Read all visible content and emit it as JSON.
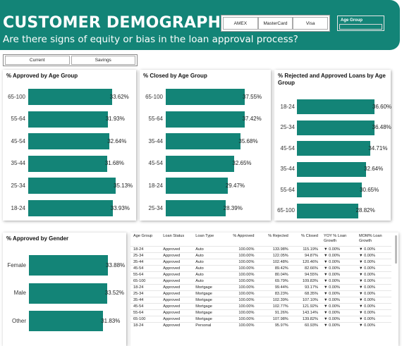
{
  "header": {
    "title": "CUSTOMER DEMOGRAPHICS",
    "subtitle": "Are there signs of equity or bias in the loan approval process?"
  },
  "card_filter": [
    "AMEX",
    "MasterCard",
    "Visa"
  ],
  "age_group_filter": {
    "label": "Age Group"
  },
  "account_toggle": [
    "Current",
    "Savings"
  ],
  "colors": {
    "accent": "#138477"
  },
  "chart_data": [
    {
      "type": "bar",
      "orientation": "horizontal",
      "title": "% Approved by Age Group",
      "categories": [
        "65-100",
        "55-64",
        "45-54",
        "35-44",
        "25-34",
        "18-24"
      ],
      "values": [
        33.62,
        31.93,
        32.64,
        31.68,
        35.13,
        33.93
      ],
      "labels": [
        "33.62%",
        "31.93%",
        "32.64%",
        "31.68%",
        "35.13%",
        "33.93%"
      ]
    },
    {
      "type": "bar",
      "orientation": "horizontal",
      "title": "% Closed by Age Group",
      "categories": [
        "65-100",
        "55-64",
        "35-44",
        "45-54",
        "18-24",
        "25-34"
      ],
      "values": [
        37.55,
        37.42,
        35.68,
        32.65,
        29.47,
        28.39
      ],
      "labels": [
        "37.55%",
        "37.42%",
        "35.68%",
        "32.65%",
        "29.47%",
        "28.39%"
      ]
    },
    {
      "type": "bar",
      "orientation": "horizontal",
      "title": "% Rejected and Approved Loans by Age Group",
      "categories": [
        "18-24",
        "25-34",
        "45-54",
        "35-44",
        "55-64",
        "65-100"
      ],
      "values": [
        36.6,
        36.48,
        34.71,
        32.64,
        30.65,
        28.82
      ],
      "labels": [
        "36.60%",
        "36.48%",
        "34.71%",
        "32.64%",
        "30.65%",
        "28.82%"
      ]
    },
    {
      "type": "bar",
      "orientation": "horizontal",
      "title": "% Approved by Gender",
      "categories": [
        "Female",
        "Male",
        "Other"
      ],
      "values": [
        33.88,
        33.52,
        31.83
      ],
      "labels": [
        "33.88%",
        "33.52%",
        "31.83%"
      ]
    }
  ],
  "table": {
    "columns": [
      "Age Group",
      "Loan Status",
      "Loan Type",
      "% Approved",
      "% Rejected",
      "% Closed",
      "YOY % Loan Growth",
      "MOM% Loan Growth"
    ],
    "rows": [
      [
        "18-24",
        "Approved",
        "Auto",
        "100.00%",
        "133.98%",
        "115.19%",
        "▼ 0.00%",
        "▼ 0.00%"
      ],
      [
        "25-34",
        "Approved",
        "Auto",
        "100.00%",
        "122.05%",
        "94.87%",
        "▼ 0.00%",
        "▼ 0.00%"
      ],
      [
        "35-44",
        "Approved",
        "Auto",
        "100.00%",
        "102.48%",
        "120.46%",
        "▼ 0.00%",
        "▼ 0.00%"
      ],
      [
        "45-54",
        "Approved",
        "Auto",
        "100.00%",
        "89.42%",
        "82.66%",
        "▼ 0.00%",
        "▼ 0.00%"
      ],
      [
        "55-64",
        "Approved",
        "Auto",
        "100.00%",
        "80.04%",
        "94.55%",
        "▼ 0.00%",
        "▼ 0.00%"
      ],
      [
        "65-100",
        "Approved",
        "Auto",
        "100.00%",
        "69.79%",
        "109.83%",
        "▼ 0.00%",
        "▼ 0.00%"
      ],
      [
        "18-24",
        "Approved",
        "Mortgage",
        "100.00%",
        "99.44%",
        "93.17%",
        "▼ 0.00%",
        "▼ 0.00%"
      ],
      [
        "25-34",
        "Approved",
        "Mortgage",
        "100.00%",
        "83.23%",
        "68.35%",
        "▼ 0.00%",
        "▼ 0.00%"
      ],
      [
        "35-44",
        "Approved",
        "Mortgage",
        "100.00%",
        "102.39%",
        "107.10%",
        "▼ 0.00%",
        "▼ 0.00%"
      ],
      [
        "45-54",
        "Approved",
        "Mortgage",
        "100.00%",
        "102.77%",
        "121.92%",
        "▼ 0.00%",
        "▼ 0.00%"
      ],
      [
        "55-64",
        "Approved",
        "Mortgage",
        "100.00%",
        "91.26%",
        "143.14%",
        "▼ 0.00%",
        "▼ 0.00%"
      ],
      [
        "65-100",
        "Approved",
        "Mortgage",
        "100.00%",
        "107.98%",
        "139.82%",
        "▼ 0.00%",
        "▼ 0.00%"
      ],
      [
        "18-24",
        "Approved",
        "Personal",
        "100.00%",
        "95.97%",
        "60.93%",
        "▼ 0.00%",
        "▼ 0.00%"
      ]
    ]
  }
}
